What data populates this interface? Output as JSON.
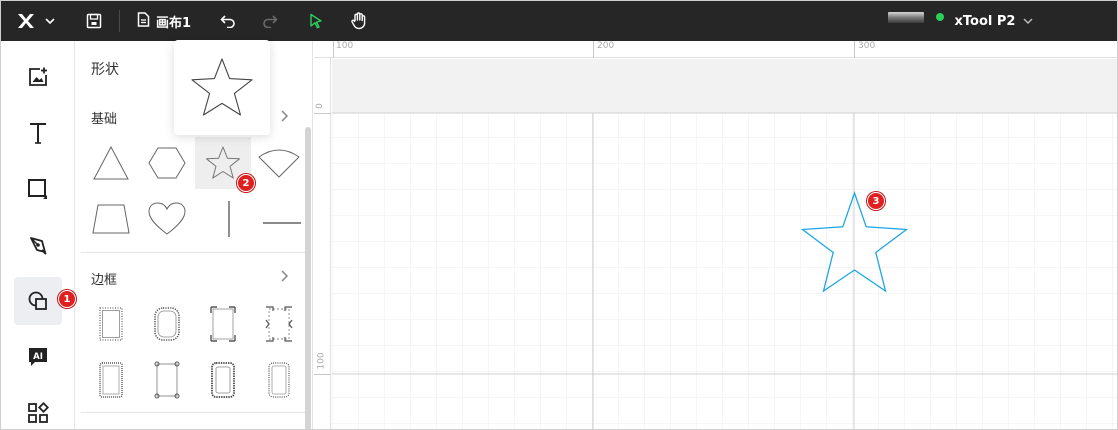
{
  "topbar": {
    "logo": "X",
    "canvas_name": "画布1",
    "device_name": "xTool P2",
    "icons": [
      "logo-x-icon",
      "chevron-down-icon",
      "save-icon",
      "file-icon",
      "undo-icon",
      "redo-icon",
      "select-pointer-icon",
      "hand-pan-icon"
    ]
  },
  "lefttools": {
    "items": [
      "image-add-icon",
      "text-icon",
      "rectangle-icon",
      "pen-icon",
      "shapes-icon",
      "ai-icon",
      "apps-icon"
    ],
    "active": "shapes-icon"
  },
  "panel": {
    "title": "形状",
    "sections": [
      {
        "title": "基础",
        "shapes": [
          "triangle",
          "hexagon",
          "star",
          "sector",
          "trapezoid",
          "heart",
          "vertical-line",
          "horizontal-line"
        ],
        "selected": "star"
      },
      {
        "title": "边框",
        "frames": [
          "frame-1",
          "frame-2",
          "frame-3",
          "frame-4",
          "frame-5",
          "frame-6",
          "frame-7",
          "frame-8"
        ]
      }
    ]
  },
  "ruler": {
    "top_labels": [
      "100",
      "200",
      "300"
    ],
    "left_labels": [
      "0",
      "100"
    ]
  },
  "canvas": {
    "shape": "star",
    "stroke_color": "#1ea6e6"
  },
  "badges": [
    "1",
    "2",
    "3"
  ],
  "colors": {
    "topbar_bg": "#262626",
    "accent_green": "#2bd05a",
    "badge_red": "#e02020"
  }
}
